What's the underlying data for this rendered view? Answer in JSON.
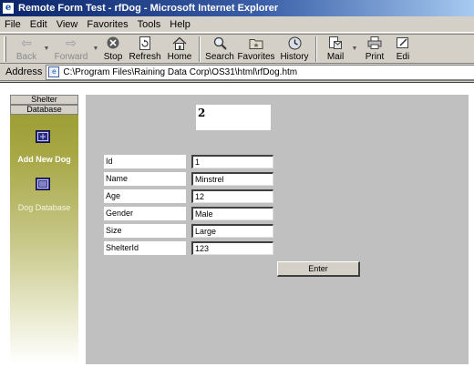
{
  "window": {
    "title": "Remote Form Test - rfDog - Microsoft Internet Explorer"
  },
  "menu": [
    "File",
    "Edit",
    "View",
    "Favorites",
    "Tools",
    "Help"
  ],
  "toolbar": {
    "back": "Back",
    "forward": "Forward",
    "stop": "Stop",
    "refresh": "Refresh",
    "home": "Home",
    "search": "Search",
    "favorites": "Favorites",
    "history": "History",
    "mail": "Mail",
    "print": "Print",
    "edit": "Edi"
  },
  "address": {
    "label": "Address",
    "url": "C:\\Program Files\\Raining Data Corp\\OS31\\html\\rfDog.htm"
  },
  "sidebar": {
    "tabs": [
      "Shelter",
      "Database"
    ],
    "links": [
      "Add New Dog",
      "Dog Database"
    ]
  },
  "form": {
    "record_number": "2",
    "fields": [
      {
        "label": "Id",
        "value": "1"
      },
      {
        "label": "Name",
        "value": "Minstrel"
      },
      {
        "label": "Age",
        "value": "12"
      },
      {
        "label": "Gender",
        "value": "Male"
      },
      {
        "label": "Size",
        "value": "Large"
      },
      {
        "label": "ShelterId",
        "value": "123"
      }
    ],
    "submit_label": "Enter"
  }
}
